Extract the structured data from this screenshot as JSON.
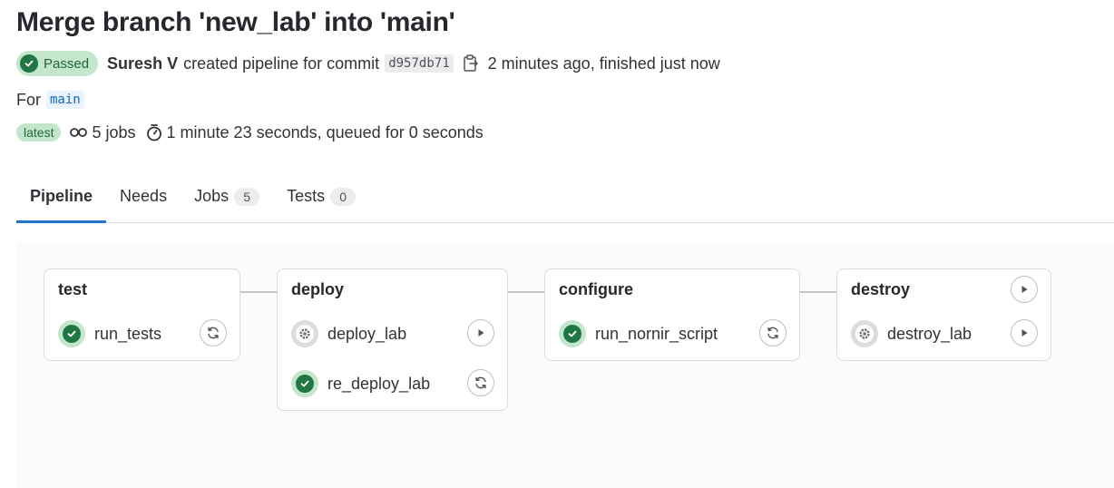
{
  "pipeline": {
    "title": "Merge branch 'new_lab' into 'main'",
    "status_label": "Passed",
    "author": "Suresh V",
    "created_text": "created pipeline for commit",
    "commit_sha": "d957db71",
    "time_text": "2 minutes ago, finished just now",
    "for_label": "For",
    "ref": "main",
    "latest_label": "latest",
    "jobs_text": "5 jobs",
    "duration_text": "1 minute 23 seconds, queued for 0 seconds"
  },
  "tabs": [
    {
      "label": "Pipeline",
      "active": true
    },
    {
      "label": "Needs"
    },
    {
      "label": "Jobs",
      "count": "5"
    },
    {
      "label": "Tests",
      "count": "0"
    }
  ],
  "stages": [
    {
      "name": "test",
      "jobs": [
        {
          "name": "run_tests",
          "status": "success",
          "action": "retry-icon"
        }
      ]
    },
    {
      "name": "deploy",
      "jobs": [
        {
          "name": "deploy_lab",
          "status": "manual",
          "action": "play-icon"
        },
        {
          "name": "re_deploy_lab",
          "status": "success",
          "action": "retry-icon"
        }
      ]
    },
    {
      "name": "configure",
      "jobs": [
        {
          "name": "run_nornir_script",
          "status": "success",
          "action": "retry-icon"
        }
      ]
    },
    {
      "name": "destroy",
      "stage_action": "play-icon",
      "jobs": [
        {
          "name": "destroy_lab",
          "status": "manual",
          "action": "play-icon"
        }
      ]
    }
  ],
  "colors": {
    "success": "#217645",
    "success_bg": "#c3e6cd",
    "tab_active": "#1f75cb",
    "ref_text": "#1068bf"
  }
}
